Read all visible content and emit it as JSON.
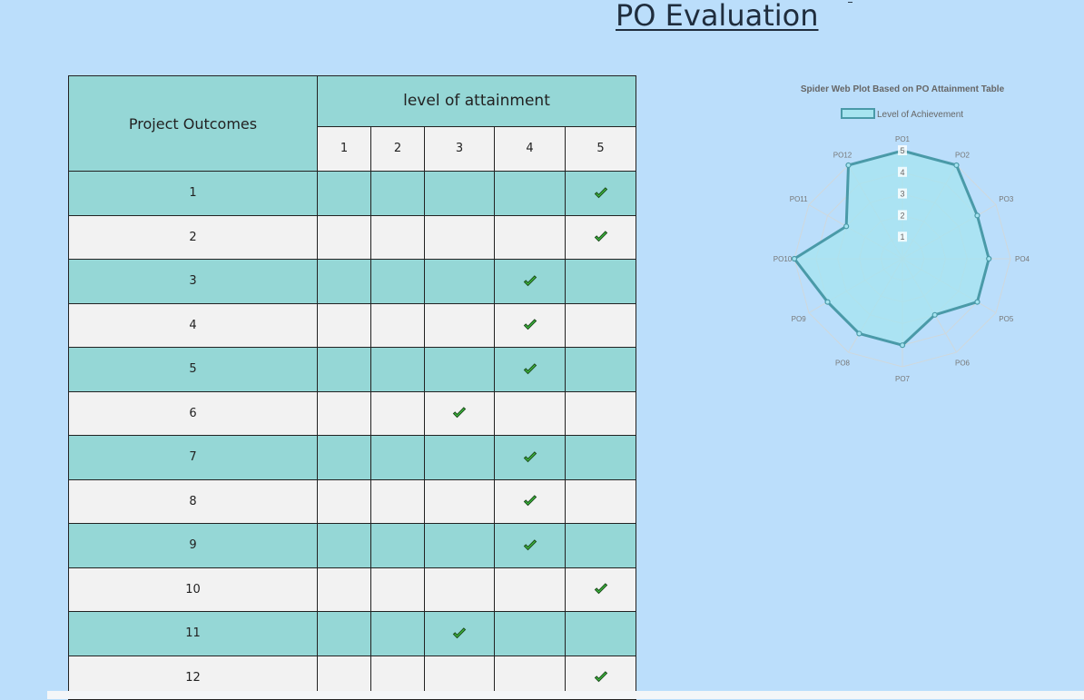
{
  "page": {
    "title": "PO Evaluation"
  },
  "table": {
    "outcomes_header": "Project Outcomes",
    "attainment_header": "level of attainment",
    "levels": [
      "1",
      "2",
      "3",
      "4",
      "5"
    ],
    "rows": [
      {
        "label": "1",
        "level": 5
      },
      {
        "label": "2",
        "level": 5
      },
      {
        "label": "3",
        "level": 4
      },
      {
        "label": "4",
        "level": 4
      },
      {
        "label": "5",
        "level": 4
      },
      {
        "label": "6",
        "level": 3
      },
      {
        "label": "7",
        "level": 4
      },
      {
        "label": "8",
        "level": 4
      },
      {
        "label": "9",
        "level": 4
      },
      {
        "label": "10",
        "level": 5
      },
      {
        "label": "11",
        "level": 3
      },
      {
        "label": "12",
        "level": 5
      }
    ]
  },
  "chart_data": {
    "type": "radar",
    "title": "Spider Web Plot Based on PO Attainment Table",
    "legend": "top",
    "grid": true,
    "categories": [
      "PO1",
      "PO2",
      "PO3",
      "PO4",
      "PO5",
      "PO6",
      "PO7",
      "PO8",
      "PO9",
      "PO10",
      "PO11",
      "PO12"
    ],
    "series": [
      {
        "name": "Level of Achievement",
        "values": [
          5,
          5,
          4,
          4,
          4,
          3,
          4,
          4,
          4,
          5,
          3,
          5
        ]
      }
    ],
    "rlim": [
      0,
      5
    ],
    "ticks": [
      "1",
      "2",
      "3",
      "4",
      "5"
    ],
    "colors": {
      "line": "#4a9aa8",
      "fill": "#a6e4f0",
      "grid": "#cfd8dc"
    }
  }
}
